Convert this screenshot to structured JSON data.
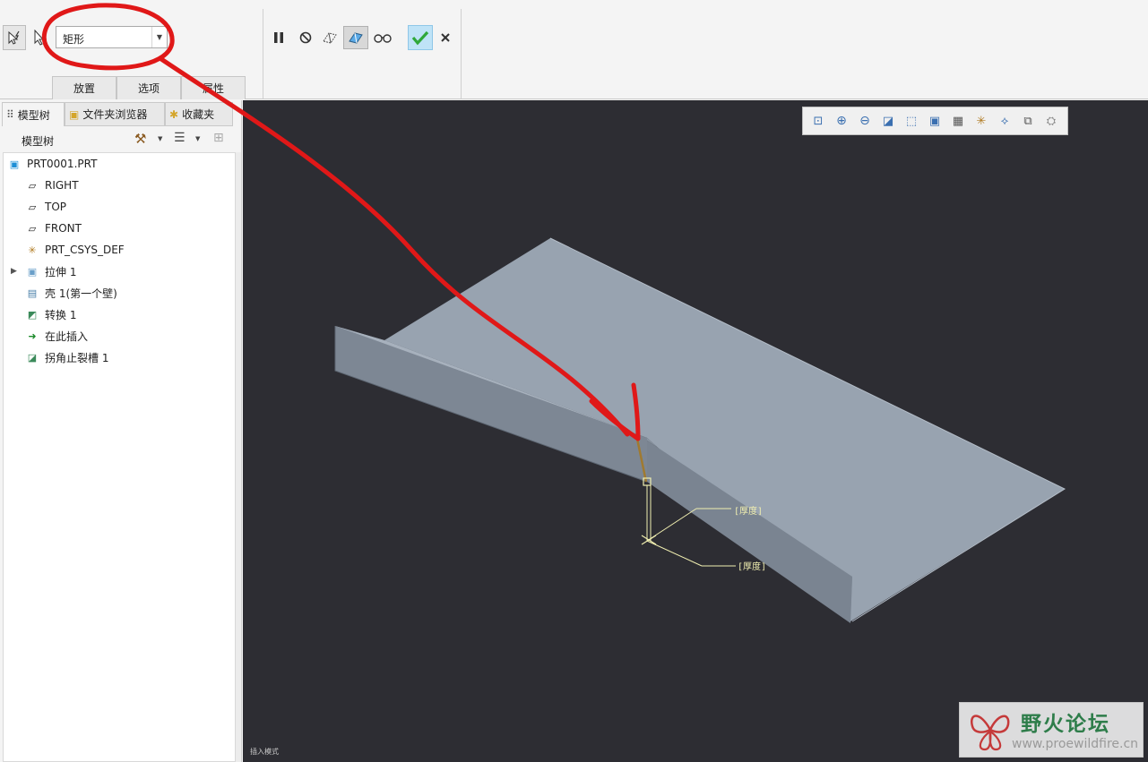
{
  "dashboard": {
    "shape_combo": {
      "value": "矩形"
    },
    "tabs": [
      "放置",
      "选项",
      "属性"
    ]
  },
  "navigator": {
    "tabs": [
      "模型树",
      "文件夹浏览器",
      "收藏夹"
    ],
    "tree_title": "模型树",
    "tree": [
      {
        "label": "PRT0001.PRT",
        "icon": "part-icon"
      },
      {
        "label": "RIGHT",
        "icon": "datum-plane-icon"
      },
      {
        "label": "TOP",
        "icon": "datum-plane-icon"
      },
      {
        "label": "FRONT",
        "icon": "datum-plane-icon"
      },
      {
        "label": "PRT_CSYS_DEF",
        "icon": "csys-icon"
      },
      {
        "label": "拉伸 1",
        "icon": "extrude-icon"
      },
      {
        "label": "壳 1(第一个壁)",
        "icon": "shell-icon"
      },
      {
        "label": "转换 1",
        "icon": "convert-icon"
      },
      {
        "label": "在此插入",
        "icon": "insert-here-arrow-icon"
      },
      {
        "label": "拐角止裂槽 1",
        "icon": "corner-relief-icon"
      }
    ]
  },
  "viewport": {
    "dimensions": [
      "[厚度]",
      "[厚度]"
    ],
    "status_mode": "插入模式"
  },
  "watermark": {
    "title": "野火论坛",
    "url": "www.proewildfire.cn"
  },
  "colors": {
    "viewport_bg": "#2d2d33",
    "part_top": "#98a3b0",
    "part_wall": "#7a8491",
    "annotation_red": "#e01818",
    "confirm_green": "#2fa83a",
    "dimension_yellow": "#f0eeb0"
  }
}
